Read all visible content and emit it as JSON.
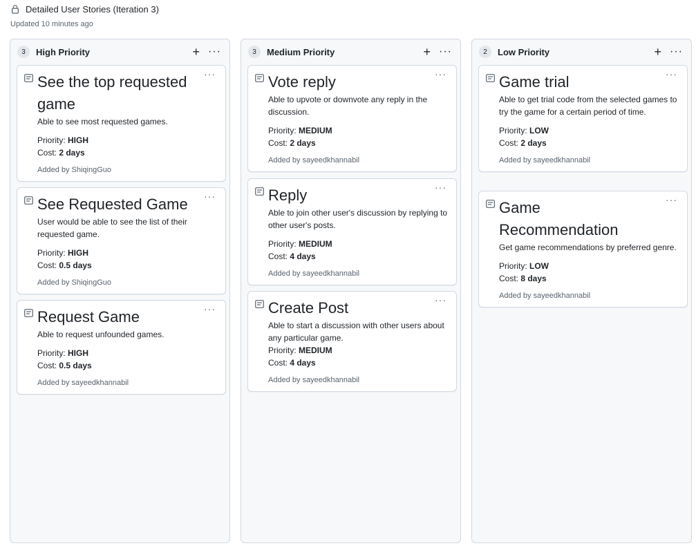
{
  "header": {
    "title": "Detailed User Stories (Iteration 3)",
    "updated": "Updated 10 minutes ago"
  },
  "columns": [
    {
      "count": "3",
      "name": "High Priority",
      "cards": [
        {
          "title": "See the top requested game",
          "desc": "Able to see most requested games.",
          "priority_label": "Priority: ",
          "priority": "HIGH",
          "cost_label": "Cost: ",
          "cost": "2 days",
          "added": "Added by ShiqingGuo"
        },
        {
          "title": "See Requested Game",
          "desc": "User would be able to see the list of their requested game.",
          "priority_label": "Priority: ",
          "priority": "HIGH",
          "cost_label": "Cost: ",
          "cost": "0.5 days",
          "added": "Added by ShiqingGuo"
        },
        {
          "title": "Request Game",
          "desc": "Able to request unfounded games.",
          "priority_label": "Priority: ",
          "priority": "HIGH",
          "cost_label": "Cost: ",
          "cost": "0.5 days",
          "added": "Added by sayeedkhannabil"
        }
      ]
    },
    {
      "count": "3",
      "name": "Medium Priority",
      "cards": [
        {
          "title": "Vote reply",
          "desc": "Able to upvote or downvote any reply in the discussion.",
          "priority_label": "Priority: ",
          "priority": "MEDIUM",
          "cost_label": "Cost: ",
          "cost": "2 days",
          "added": "Added by sayeedkhannabil"
        },
        {
          "title": "Reply",
          "desc": "Able to join other user's discussion by replying to other user's posts.",
          "priority_label": "Priority: ",
          "priority": "MEDIUM",
          "cost_label": "Cost: ",
          "cost": "4 days",
          "added": "Added by sayeedkhannabil"
        },
        {
          "title": "Create Post",
          "desc": "Able to start a discussion with other users about any particular game.",
          "priority_label": "Priority: ",
          "priority": "MEDIUM",
          "cost_label": "Cost: ",
          "cost": "4 days",
          "added": "Added by sayeedkhannabil"
        }
      ]
    },
    {
      "count": "2",
      "name": "Low Priority",
      "cards": [
        {
          "title": "Game trial",
          "desc": "Able to get trial code from the selected games to try the game for a certain period of time.",
          "priority_label": "Priority: ",
          "priority": "LOW",
          "cost_label": "Cost: ",
          "cost": "2 days",
          "added": "Added by sayeedkhannabil"
        },
        {
          "title": "Game Recommendation",
          "desc": "Get game recommendations by preferred genre.",
          "priority_label": "Priority: ",
          "priority": "LOW",
          "cost_label": "Cost: ",
          "cost": "8 days",
          "added": "Added by sayeedkhannabil"
        }
      ]
    }
  ],
  "icons": {
    "add": "+",
    "more": "···"
  }
}
